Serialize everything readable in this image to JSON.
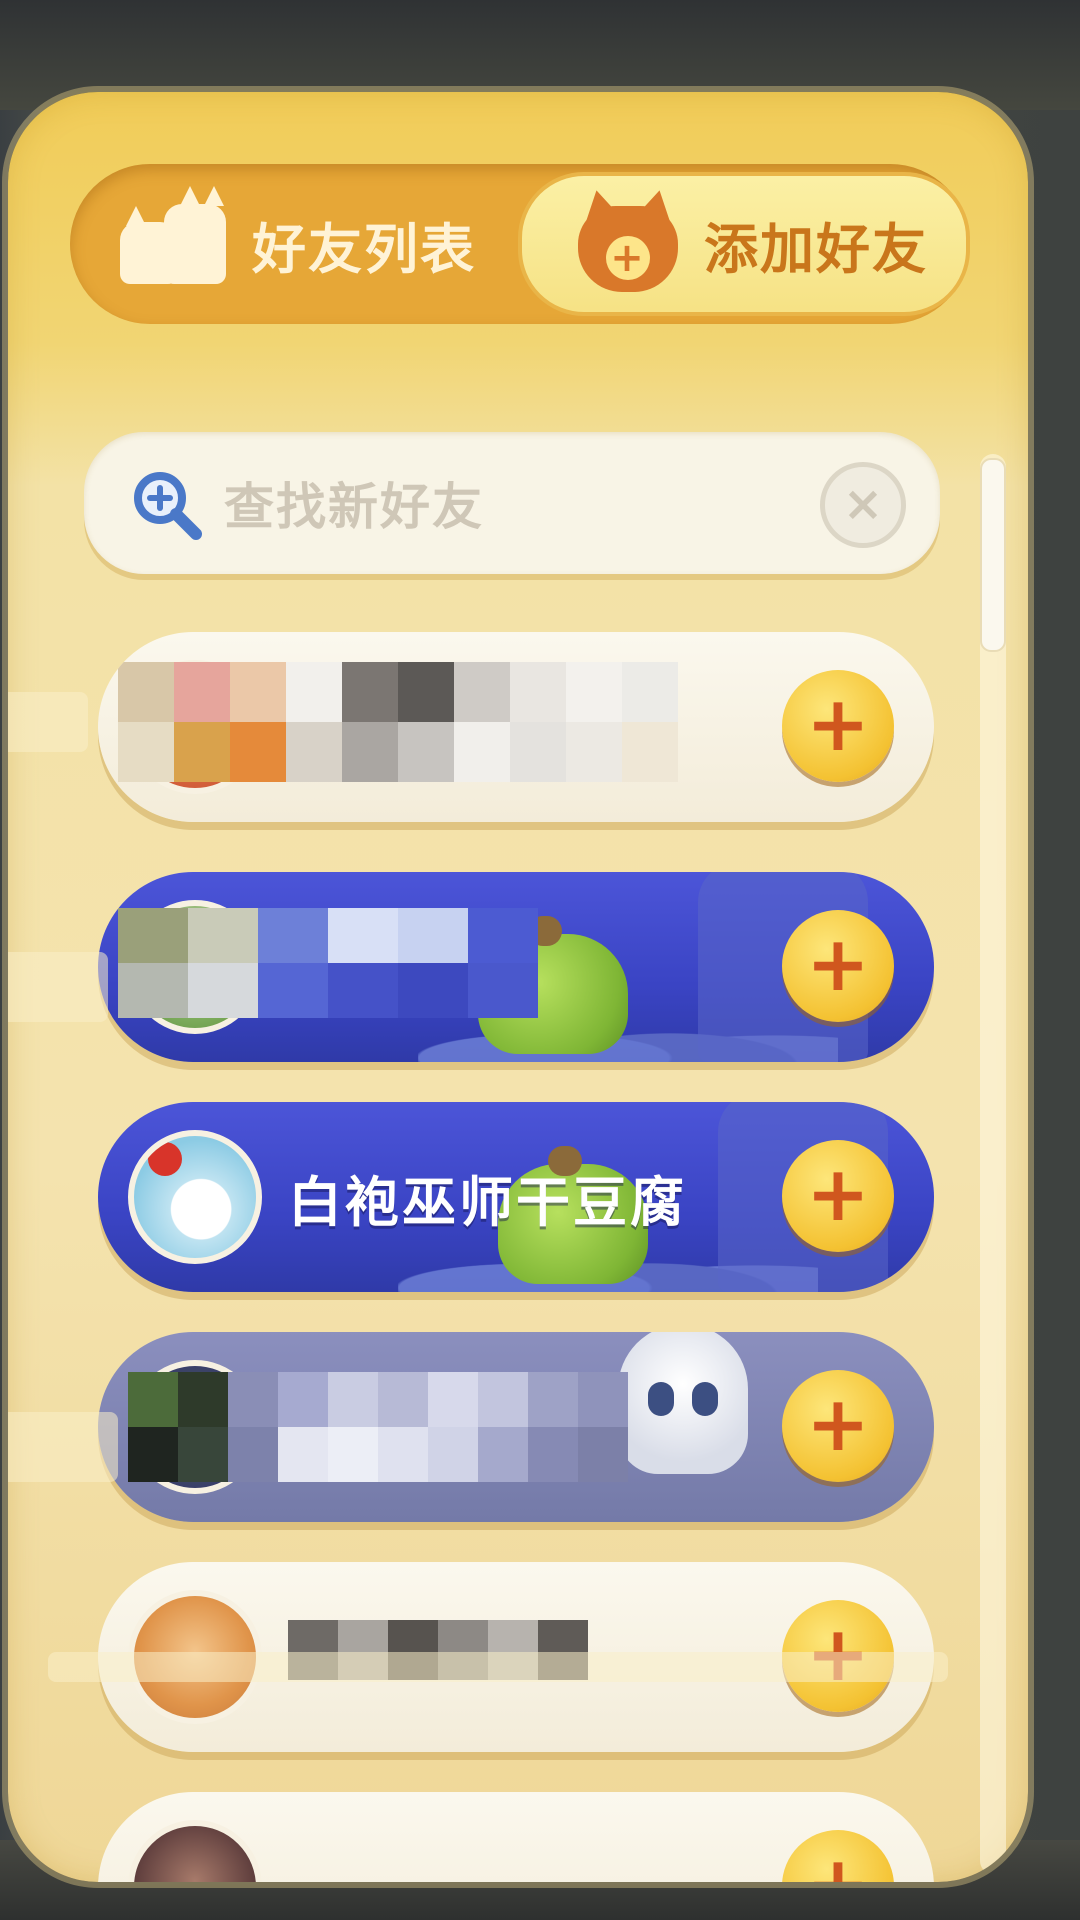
{
  "tabs": {
    "friends_label": "好友列表",
    "add_label": "添加好友"
  },
  "search": {
    "placeholder": "查找新好友",
    "clear_symbol": "×"
  },
  "friends": [
    {
      "name": "",
      "style": "light",
      "add_symbol": "+"
    },
    {
      "name": "",
      "style": "blue",
      "add_symbol": "+"
    },
    {
      "name": "白袍巫师干豆腐",
      "style": "blue",
      "add_symbol": "+"
    },
    {
      "name": "",
      "style": "gray",
      "add_symbol": "+"
    },
    {
      "name": "",
      "style": "light",
      "add_symbol": "+"
    },
    {
      "name": "",
      "style": "light",
      "add_symbol": "+"
    }
  ],
  "colors": {
    "panel_yellow": "#f1cc58",
    "tab_orange": "#e6a737",
    "card_blue": "#3a44c4",
    "add_button_yellow": "#f4c232",
    "add_plus_red": "#d0571e",
    "search_icon_blue": "#4a78c8"
  },
  "icons": {
    "friends_tab": "friends-group-icon",
    "add_tab": "cat-add-icon",
    "search": "search-plus-icon",
    "clear": "close-circle-icon",
    "add_friend": "plus-circle-icon"
  }
}
